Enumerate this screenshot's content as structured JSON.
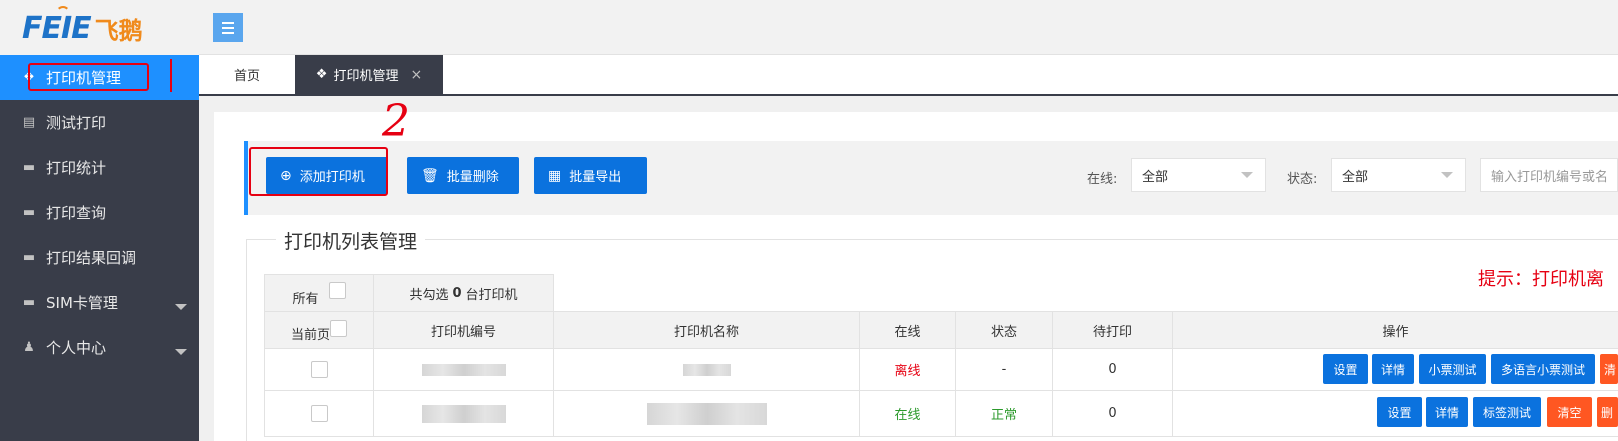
{
  "logo": {
    "en": "FEIE",
    "cn": "飞鹅"
  },
  "sidebar": {
    "items": [
      {
        "label": "打印机管理",
        "icon": "cubes-icon"
      },
      {
        "label": "测试打印",
        "icon": "file-icon"
      },
      {
        "label": "打印统计",
        "icon": "monitor-icon"
      },
      {
        "label": "打印查询",
        "icon": "monitor-icon"
      },
      {
        "label": "打印结果回调",
        "icon": "monitor-icon"
      },
      {
        "label": "SIM卡管理",
        "icon": "monitor-icon"
      },
      {
        "label": "个人中心",
        "icon": "user-icon"
      }
    ]
  },
  "tabs": [
    {
      "label": "首页"
    },
    {
      "label": "打印机管理",
      "close": "×"
    }
  ],
  "annotation": {
    "step": "2"
  },
  "toolbar": {
    "add_label": "添加打印机",
    "batch_delete_label": "批量删除",
    "batch_export_label": "批量导出",
    "online_label": "在线:",
    "online_value": "全部",
    "status_label": "状态:",
    "status_value": "全部",
    "search_placeholder": "输入打印机编号或名"
  },
  "list": {
    "legend": "打印机列表管理",
    "hint": "提示：打印机离",
    "all_label": "所有",
    "selected_text_pre": "共勾选",
    "selected_count": "0",
    "selected_text_post": "台打印机",
    "current_page_label": "当前页",
    "columns": [
      "打印机编号",
      "打印机名称",
      "在线",
      "状态",
      "待打印",
      "操作"
    ],
    "rows": [
      {
        "online": "离线",
        "status": "-",
        "pending": "0",
        "ops": [
          "设置",
          "详情",
          "小票测试",
          "多语言小票测试",
          "清"
        ]
      },
      {
        "online": "在线",
        "status": "正常",
        "pending": "0",
        "ops": [
          "设置",
          "详情",
          "标签测试",
          "清空",
          "删"
        ]
      }
    ]
  },
  "colors": {
    "sidebar": "#393d49",
    "accent": "#1e90ff",
    "button": "#0b72de",
    "orange": "#ff5722",
    "annotation": "#e60012"
  }
}
